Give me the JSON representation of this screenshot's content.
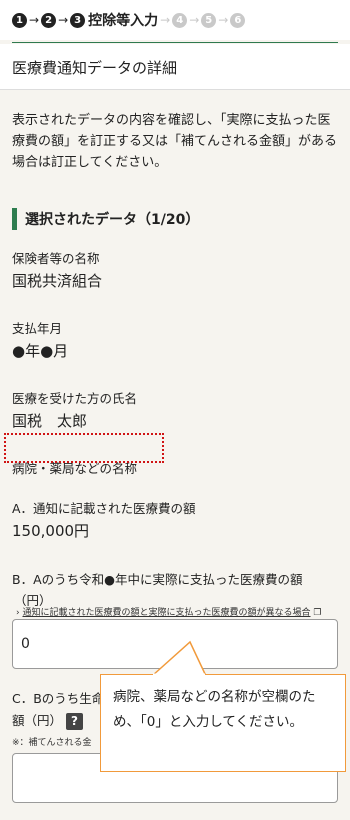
{
  "stepper": {
    "steps": [
      "1",
      "2",
      "3",
      "4",
      "5",
      "6"
    ],
    "current_label": "控除等入力"
  },
  "page_title": "医療費通知データの詳細",
  "intro_text": "表示されたデータの内容を確認し、「実際に支払った医療費の額」を訂正する又は「補てんされる金額」がある場合は訂正してください。",
  "section": {
    "title": "選択されたデータ（1/20）"
  },
  "fields": {
    "insurer_label": "保険者等の名称",
    "insurer_value": "国税共済組合",
    "paid_month_label": "支払年月",
    "paid_month_value": "●年●月",
    "patient_label": "医療を受けた方の氏名",
    "patient_value": "国税　太郎",
    "hospital_label": "病院・薬局などの名称",
    "hospital_value": "",
    "a_label": "A．通知に記載された医療費の額",
    "a_value": "150,000円",
    "b_label_line1": "B．Aのうち令和●年中に実際に支払った医療費の額",
    "b_label_line2": "（円）",
    "b_link": "通知に記載された医療費の額と実際に支払った医療費の額が異なる場合",
    "b_input_value": "0",
    "c_label_line1": "C．Bのうち生命保険や社会保険などで補てんされる金",
    "c_label_line2": "額（円）",
    "c_help": "?",
    "c_note": "※：補てんされる金",
    "c_input_value": ""
  },
  "callout": {
    "text": "病院、薬局などの名称が空欄のため、「0」と入力してください。",
    "border_color": "#f19a3b"
  },
  "colors": {
    "accent_green": "#2e7d4f",
    "dotted_red": "#d01414"
  }
}
